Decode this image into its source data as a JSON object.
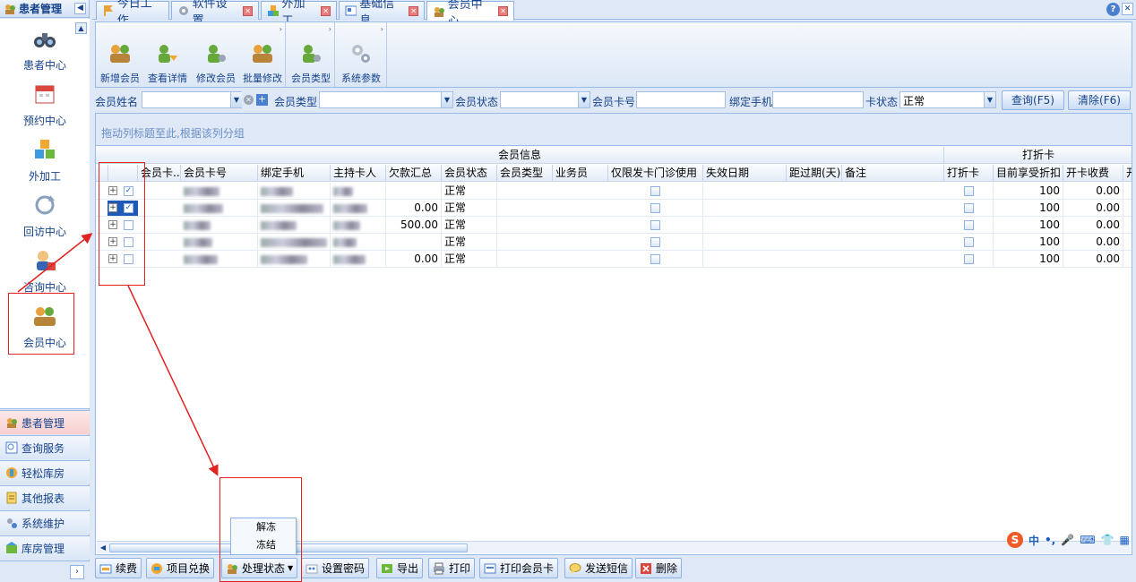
{
  "sidebar": {
    "header": "患者管理",
    "nav": [
      {
        "label": "患者中心",
        "icon": "binoculars-icon"
      },
      {
        "label": "预约中心",
        "icon": "calendar-icon"
      },
      {
        "label": "外加工",
        "icon": "cubes-icon"
      },
      {
        "label": "回访中心",
        "icon": "refresh-icon"
      },
      {
        "label": "咨询中心",
        "icon": "consult-user-icon"
      },
      {
        "label": "会员中心",
        "icon": "members-icon"
      }
    ],
    "categories": [
      {
        "label": "患者管理",
        "icon": "patients-icon"
      },
      {
        "label": "查询服务",
        "icon": "query-icon"
      },
      {
        "label": "轻松库房",
        "icon": "warehouse-icon"
      },
      {
        "label": "其他报表",
        "icon": "report-icon"
      },
      {
        "label": "系统维护",
        "icon": "maintenance-icon"
      },
      {
        "label": "库房管理",
        "icon": "storage-icon"
      }
    ]
  },
  "tabs": [
    {
      "label": "今日工作"
    },
    {
      "label": "软件设置"
    },
    {
      "label": "外加工"
    },
    {
      "label": "基础信息"
    },
    {
      "label": "会员中心"
    }
  ],
  "ribbon": {
    "buttons": [
      {
        "label": "新增会员"
      },
      {
        "label": "查看详情"
      },
      {
        "label": "修改会员"
      },
      {
        "label": "批量修改"
      },
      {
        "label": "会员类型"
      },
      {
        "label": "系统参数"
      }
    ]
  },
  "filter": {
    "member_name_label": "会员姓名",
    "member_type_label": "会员类型",
    "member_status_label": "会员状态",
    "card_no_label": "会员卡号",
    "phone_label": "绑定手机",
    "card_status_label": "卡状态",
    "card_status_value": "正常",
    "query_button": "查询(F5)",
    "clear_button": "清除(F6)"
  },
  "grid": {
    "group_hint": "拖动列标题至此,根据该列分组",
    "band_member": "会员信息",
    "band_discount": "打折卡",
    "columns": [
      "会员卡...",
      "会员卡号",
      "绑定手机",
      "主持卡人",
      "欠款汇总",
      "会员状态",
      "会员类型",
      "业务员",
      "仅限发卡门诊使用",
      "失效日期",
      "距过期(天)",
      "备注",
      "打折卡",
      "目前享受折扣",
      "开卡收费",
      "开"
    ],
    "rows": [
      {
        "debt": "",
        "status": "正常",
        "discount": "100",
        "fee": "0.00"
      },
      {
        "debt": "0.00",
        "status": "正常",
        "discount": "100",
        "fee": "0.00"
      },
      {
        "debt": "500.00",
        "status": "正常",
        "discount": "100",
        "fee": "0.00"
      },
      {
        "debt": "",
        "status": "正常",
        "discount": "100",
        "fee": "0.00"
      },
      {
        "debt": "0.00",
        "status": "正常",
        "discount": "100",
        "fee": "0.00"
      }
    ]
  },
  "context_menu": {
    "items": [
      {
        "label": "解冻"
      },
      {
        "label": "冻结"
      }
    ]
  },
  "bottombar": {
    "buttons": [
      {
        "label": "续费"
      },
      {
        "label": "项目兑换"
      },
      {
        "label": "处理状态"
      },
      {
        "label": "设置密码"
      },
      {
        "label": "导出"
      },
      {
        "label": "打印"
      },
      {
        "label": "打印会员卡"
      },
      {
        "label": "发送短信"
      },
      {
        "label": "删除"
      }
    ]
  },
  "ime": {
    "label": "中"
  }
}
